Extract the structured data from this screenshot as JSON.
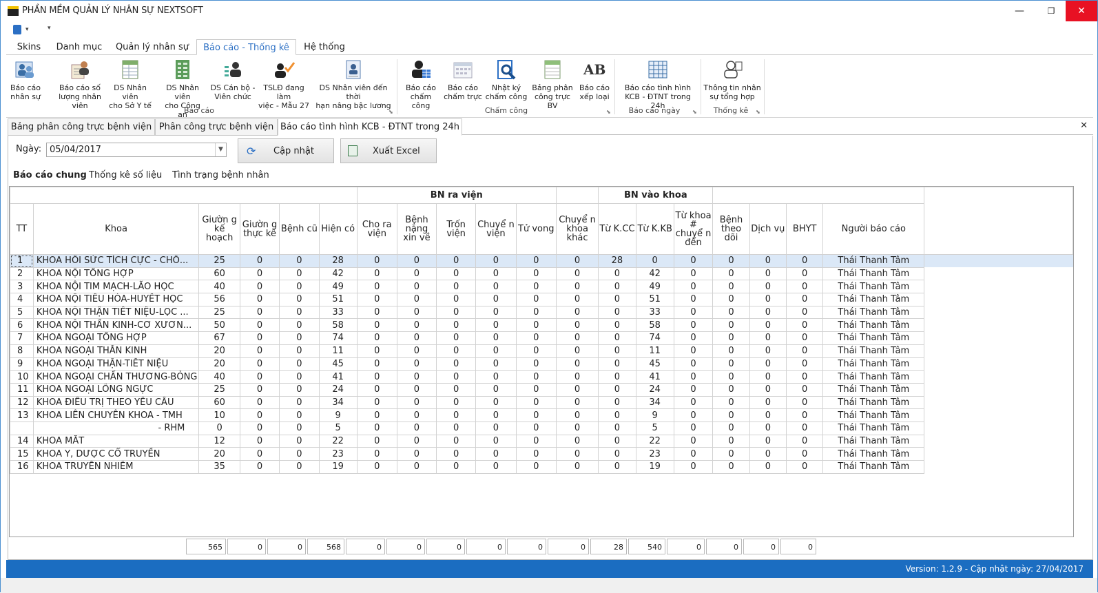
{
  "window": {
    "title": "PHẦN MỀM QUẢN LÝ NHÂN SỰ NEXTSOFT",
    "minimize": "—",
    "maximize": "❐",
    "close": "✕"
  },
  "ribbon_tabs": [
    "Skins",
    "Danh mục",
    "Quản lý nhân sự",
    "Báo cáo - Thống kê",
    "Hệ thống"
  ],
  "ribbon": {
    "buttons": [
      {
        "l1": "Báo cáo",
        "l2": "nhân sự",
        "icon": "people-report-icon"
      },
      {
        "l1": "Báo cáo số",
        "l2": "lượng nhân viên",
        "icon": "staff-count-icon"
      },
      {
        "l1": "DS Nhân viên",
        "l2": "cho Sở Y tế",
        "icon": "spreadsheet-icon"
      },
      {
        "l1": "DS Nhân viên",
        "l2": "cho Công an",
        "icon": "green-sheet-icon"
      },
      {
        "l1": "DS Cán bộ -",
        "l2": "Viên chức",
        "icon": "officer-icon"
      },
      {
        "l1": "TSLĐ đang làm",
        "l2": "việc - Mẫu 27",
        "icon": "checked-staff-icon"
      },
      {
        "l1": "DS Nhân viên đến thời",
        "l2": "hạn nâng bậc lương",
        "icon": "badge-icon"
      },
      {
        "l1": "Báo cáo",
        "l2": "chấm công",
        "icon": "timesheet-person-icon"
      },
      {
        "l1": "Báo cáo",
        "l2": "chấm trực",
        "icon": "calendar-icon"
      },
      {
        "l1": "Nhật ký",
        "l2": "chấm công",
        "icon": "magnifier-doc-icon"
      },
      {
        "l1": "Bảng phân",
        "l2": "công trực BV",
        "icon": "roster-sheet-icon"
      },
      {
        "l1": "Báo cáo",
        "l2": "xếp loại",
        "icon": "ab-icon",
        "glyph": "AB"
      },
      {
        "l1": "Báo cáo tình hình",
        "l2": "KCB - ĐTNT trong 24h",
        "icon": "grid-report-icon"
      },
      {
        "l1": "Thông tin nhân",
        "l2": "sự tổng hợp",
        "icon": "summary-person-icon"
      }
    ],
    "groups": [
      "Báo cáo",
      "Chấm công",
      "Báo cáo ngày",
      "Thống kê"
    ]
  },
  "doc_tabs": [
    "Bảng phân công trực bệnh viện",
    "Phân công trực bệnh viện",
    "Báo cáo tình hình KCB - ĐTNT trong 24h"
  ],
  "filter": {
    "date_label": "Ngày:",
    "date_value": "05/04/2017",
    "update_label": "Cập nhật",
    "excel_label": "Xuất Excel"
  },
  "sub_tabs": [
    "Báo cáo chung",
    "Thống kê số liệu",
    "Tình trạng bệnh nhân"
  ],
  "table": {
    "group_headers": {
      "out": "BN ra viện",
      "in": "BN vào khoa"
    },
    "columns": [
      "TT",
      "Khoa",
      "Giườn g kế hoạch",
      "Giườn g thực kê",
      "Bệnh cũ",
      "Hiện có",
      "Cho ra viện",
      "Bệnh nặng xin về",
      "Trốn viện",
      "Chuyể n viện",
      "Tử vong",
      "Chuyể n khoa khác",
      "Từ K.CC",
      "Từ K.KB",
      "Từ khoa # chuyể n đến",
      "Bệnh theo dõi",
      "Dịch vụ",
      "BHYT",
      "Người báo cáo"
    ],
    "rows": [
      [
        "1",
        "KHOA HỒI SỨC TÍCH CỰC - CHỐ...",
        "25",
        "0",
        "0",
        "28",
        "0",
        "0",
        "0",
        "0",
        "0",
        "0",
        "28",
        "0",
        "0",
        "0",
        "0",
        "0",
        "Thái Thanh Tâm"
      ],
      [
        "2",
        "KHOA NỘI TỔNG HỢP",
        "60",
        "0",
        "0",
        "42",
        "0",
        "0",
        "0",
        "0",
        "0",
        "0",
        "0",
        "42",
        "0",
        "0",
        "0",
        "0",
        "Thái Thanh Tâm"
      ],
      [
        "3",
        "KHOA NỘI TIM MẠCH-LÃO HỌC",
        "40",
        "0",
        "0",
        "49",
        "0",
        "0",
        "0",
        "0",
        "0",
        "0",
        "0",
        "49",
        "0",
        "0",
        "0",
        "0",
        "Thái Thanh Tâm"
      ],
      [
        "4",
        "KHOA NỘI TIÊU HÓA-HUYẾT HỌC",
        "56",
        "0",
        "0",
        "51",
        "0",
        "0",
        "0",
        "0",
        "0",
        "0",
        "0",
        "51",
        "0",
        "0",
        "0",
        "0",
        "Thái Thanh Tâm"
      ],
      [
        "5",
        "KHOA NỘI THẬN TIẾT NIỆU-LỌC ...",
        "25",
        "0",
        "0",
        "33",
        "0",
        "0",
        "0",
        "0",
        "0",
        "0",
        "0",
        "33",
        "0",
        "0",
        "0",
        "0",
        "Thái Thanh Tâm"
      ],
      [
        "6",
        "KHOA NỘI THẦN KINH-CƠ XƯƠN...",
        "50",
        "0",
        "0",
        "58",
        "0",
        "0",
        "0",
        "0",
        "0",
        "0",
        "0",
        "58",
        "0",
        "0",
        "0",
        "0",
        "Thái Thanh Tâm"
      ],
      [
        "7",
        "KHOA NGOẠI TỔNG HỢP",
        "67",
        "0",
        "0",
        "74",
        "0",
        "0",
        "0",
        "0",
        "0",
        "0",
        "0",
        "74",
        "0",
        "0",
        "0",
        "0",
        "Thái Thanh Tâm"
      ],
      [
        "8",
        "KHOA NGOẠI THẦN KINH",
        "20",
        "0",
        "0",
        "11",
        "0",
        "0",
        "0",
        "0",
        "0",
        "0",
        "0",
        "11",
        "0",
        "0",
        "0",
        "0",
        "Thái Thanh Tâm"
      ],
      [
        "9",
        "KHOA NGOẠI THẬN-TIẾT NIỆU",
        "20",
        "0",
        "0",
        "45",
        "0",
        "0",
        "0",
        "0",
        "0",
        "0",
        "0",
        "45",
        "0",
        "0",
        "0",
        "0",
        "Thái Thanh Tâm"
      ],
      [
        "10",
        "KHOA NGOẠI CHẤN THƯƠNG-BỎNG",
        "40",
        "0",
        "0",
        "41",
        "0",
        "0",
        "0",
        "0",
        "0",
        "0",
        "0",
        "41",
        "0",
        "0",
        "0",
        "0",
        "Thái Thanh Tâm"
      ],
      [
        "11",
        "KHOA NGOẠI LỒNG NGỰC",
        "25",
        "0",
        "0",
        "24",
        "0",
        "0",
        "0",
        "0",
        "0",
        "0",
        "0",
        "24",
        "0",
        "0",
        "0",
        "0",
        "Thái Thanh Tâm"
      ],
      [
        "12",
        "KHOA ĐIỀU TRỊ THEO YÊU CẦU",
        "60",
        "0",
        "0",
        "34",
        "0",
        "0",
        "0",
        "0",
        "0",
        "0",
        "0",
        "34",
        "0",
        "0",
        "0",
        "0",
        "Thái Thanh Tâm"
      ],
      [
        "13",
        "KHOA LIÊN CHUYÊN KHOA - TMH",
        "10",
        "0",
        "0",
        "9",
        "0",
        "0",
        "0",
        "0",
        "0",
        "0",
        "0",
        "9",
        "0",
        "0",
        "0",
        "0",
        "Thái Thanh Tâm"
      ],
      [
        "",
        "- RHM",
        "0",
        "0",
        "0",
        "5",
        "0",
        "0",
        "0",
        "0",
        "0",
        "0",
        "0",
        "5",
        "0",
        "0",
        "0",
        "0",
        "Thái Thanh Tâm"
      ],
      [
        "14",
        "KHOA MẮT",
        "12",
        "0",
        "0",
        "22",
        "0",
        "0",
        "0",
        "0",
        "0",
        "0",
        "0",
        "22",
        "0",
        "0",
        "0",
        "0",
        "Thái Thanh Tâm"
      ],
      [
        "15",
        "KHOA Y, DƯỢC CỔ TRUYỀN",
        "20",
        "0",
        "0",
        "23",
        "0",
        "0",
        "0",
        "0",
        "0",
        "0",
        "0",
        "23",
        "0",
        "0",
        "0",
        "0",
        "Thái Thanh Tâm"
      ],
      [
        "16",
        "KHOA TRUYỀN NHIỄM",
        "35",
        "0",
        "0",
        "19",
        "0",
        "0",
        "0",
        "0",
        "0",
        "0",
        "0",
        "19",
        "0",
        "0",
        "0",
        "0",
        "Thái Thanh Tâm"
      ]
    ],
    "totals": [
      "565",
      "0",
      "0",
      "568",
      "0",
      "0",
      "0",
      "0",
      "0",
      "0",
      "28",
      "540",
      "0",
      "0",
      "0",
      "0"
    ]
  },
  "status": "Version: 1.2.9 - Cập nhật ngày: 27/04/2017",
  "colors": {
    "accent": "#2b6fc4",
    "status_bar": "#1b6dc1",
    "selected_row": "#dbe8f7",
    "close_button": "#e81123"
  }
}
